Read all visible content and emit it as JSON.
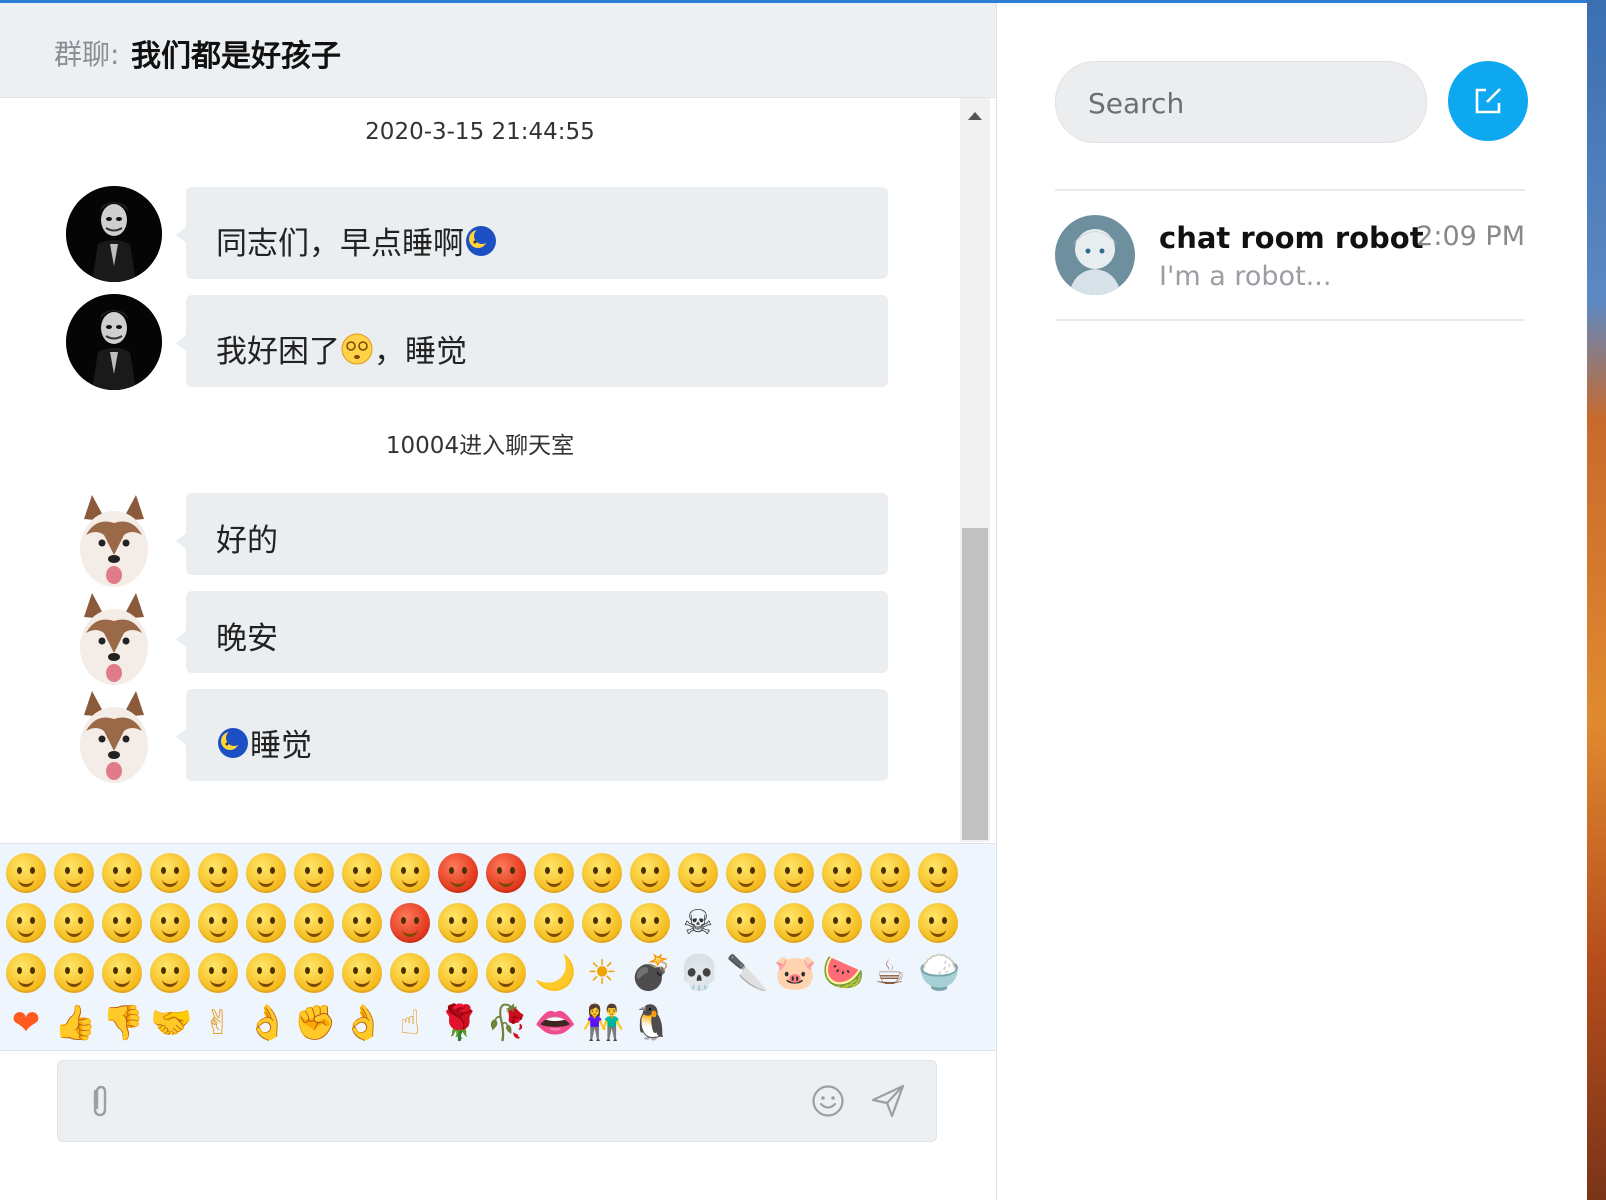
{
  "chat": {
    "prefix": "群聊:",
    "title": "我们都是好孩子",
    "timestamp": "2020-3-15 21:44:55",
    "system_message": "10004进入聊天室",
    "messages": [
      {
        "sender": "joker",
        "text_before": "同志们，早点睡啊",
        "emoji": "moon",
        "text_after": ""
      },
      {
        "sender": "joker",
        "text_before": "我好困了",
        "emoji": "dizzy-face",
        "text_after": "，睡觉"
      },
      {
        "sender": "husky",
        "text_before": "好的",
        "emoji": "",
        "text_after": ""
      },
      {
        "sender": "husky",
        "text_before": "晚安",
        "emoji": "",
        "text_after": ""
      },
      {
        "sender": "husky",
        "text_before": "",
        "emoji": "moon",
        "text_after": "睡觉"
      }
    ]
  },
  "emoji_panel": {
    "icons": [
      "smile",
      "pout",
      "heart-eyes",
      "dizzy",
      "cry",
      "shy",
      "silent",
      "sleep",
      "tears",
      "awkward",
      "angry",
      "tongue",
      "grin",
      "surprise",
      "sad",
      "cool",
      "puke",
      "embarrassed",
      "giggle",
      "pleased",
      "shock",
      "proud",
      "hungry",
      "sleepy",
      "scared",
      "sweat",
      "laugh",
      "soldier",
      "struggle",
      "curse",
      "question",
      "shush",
      "dizzy-eyes",
      "tormented",
      "skull",
      "whisper",
      "pick-nose",
      "smug",
      "blush",
      "sigh",
      "applause",
      "snicker",
      "doubt",
      "heh",
      "yawn",
      "wronged",
      "grimace",
      "kiss",
      "frightened",
      "wilt",
      "dummy",
      "moon",
      "sun",
      "bomb",
      "skull-2",
      "cleaver",
      "pig",
      "watermelon",
      "coffee",
      "rice",
      "heart",
      "thumbs-up",
      "thumbs-down",
      "handshake",
      "victory",
      "salute",
      "fist",
      "ok",
      "point-up",
      "rose",
      "wilted-rose",
      "lips",
      "couple",
      "penguin"
    ]
  },
  "composer": {
    "placeholder": "",
    "value": ""
  },
  "sidebar": {
    "search_placeholder": "Search",
    "contacts": [
      {
        "name": "chat room robot",
        "time": "2:09 PM",
        "preview": "I'm a robot..."
      }
    ]
  },
  "colors": {
    "accent": "#0da8f0",
    "bubble": "#ebeef1",
    "header_bg": "#edf0f3",
    "emoji_bg": "#eef5fd"
  }
}
